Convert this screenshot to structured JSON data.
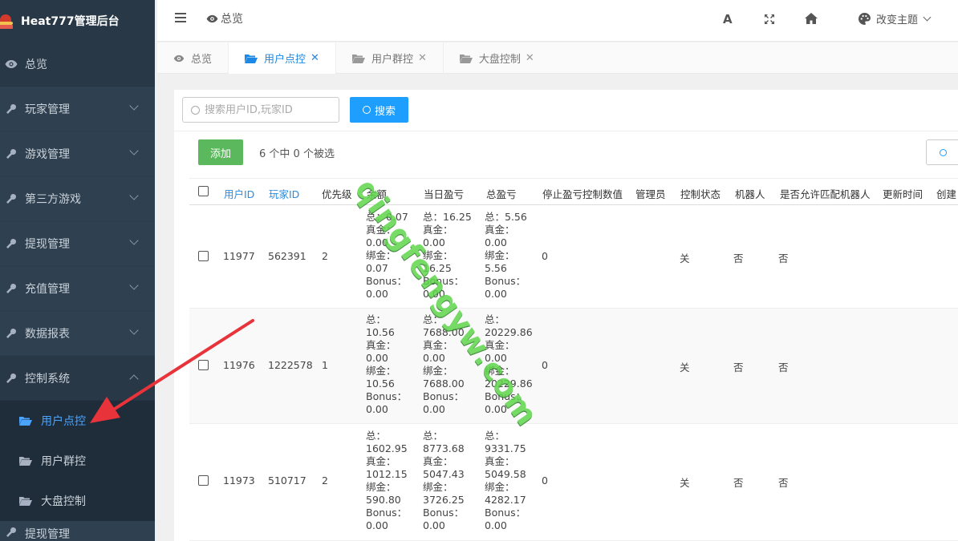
{
  "brand": {
    "title": "Heat777管理后台"
  },
  "sidebar": {
    "overview": "总览",
    "items": [
      {
        "label": "玩家管理",
        "icon": "wrench-icon"
      },
      {
        "label": "游戏管理",
        "icon": "wrench-icon"
      },
      {
        "label": "第三方游戏",
        "icon": "wrench-icon"
      },
      {
        "label": "提现管理",
        "icon": "wrench-icon"
      },
      {
        "label": "充值管理",
        "icon": "wrench-icon"
      },
      {
        "label": "数据报表",
        "icon": "wrench-icon"
      },
      {
        "label": "控制系统",
        "icon": "wrench-icon",
        "open": true
      }
    ],
    "sub_items": [
      {
        "label": "用户点控",
        "active": true
      },
      {
        "label": "用户群控"
      },
      {
        "label": "大盘控制"
      }
    ],
    "partial_next": "提现管理"
  },
  "header": {
    "breadcrumb": "总览",
    "theme_label": "改变主题"
  },
  "tabs": [
    {
      "label": "总览",
      "icon": "eye-icon",
      "closable": false
    },
    {
      "label": "用户点控",
      "icon": "folder-open-icon",
      "closable": true,
      "active": true
    },
    {
      "label": "用户群控",
      "icon": "folder-open-icon",
      "closable": true
    },
    {
      "label": "大盘控制",
      "icon": "folder-open-icon",
      "closable": true
    }
  ],
  "toolbar": {
    "search_placeholder": "搜索用户ID,玩家ID",
    "search_button": "搜索",
    "add_button": "添加",
    "selection_info": "6 个中 0 个被选"
  },
  "table": {
    "columns": [
      "用户ID",
      "玩家ID",
      "优先级",
      "余额",
      "当日盈亏",
      "总盈亏",
      "停止盈亏控制数值",
      "管理员",
      "控制状态",
      "机器人",
      "是否允许匹配机器人",
      "更新时间",
      "创建"
    ],
    "rows": [
      {
        "user_id": "11977",
        "player_id": "562391",
        "priority": "2",
        "balance": [
          "总：0.07",
          "真金：",
          "0.00",
          "绑金：",
          "0.07",
          "Bonus：",
          "0.00"
        ],
        "daily": [
          "总：16.25",
          "真金：",
          "0.00",
          "绑金：",
          "16.25",
          "Bonus：",
          "0.00"
        ],
        "total": [
          "总：5.56",
          "真金：",
          "0.00",
          "绑金：",
          "5.56",
          "Bonus：",
          "0.00"
        ],
        "stop_value": "0",
        "status": "关",
        "robot": "否",
        "allow_robot": "否"
      },
      {
        "user_id": "11976",
        "player_id": "1222578",
        "priority": "1",
        "balance": [
          "总：",
          "10.56",
          "真金：",
          "0.00",
          "绑金：",
          "10.56",
          "Bonus：",
          "0.00"
        ],
        "daily": [
          "总：",
          "7688.00",
          "真金：",
          "0.00",
          "绑金：",
          "7688.00",
          "Bonus：",
          "0.00"
        ],
        "total": [
          "总：",
          "20229.86",
          "真金：",
          "0.00",
          "绑金：",
          "20229.86",
          "Bonus：",
          "0.00"
        ],
        "stop_value": "0",
        "status": "关",
        "robot": "否",
        "allow_robot": "否"
      },
      {
        "user_id": "11973",
        "player_id": "510717",
        "priority": "2",
        "balance": [
          "总：",
          "1602.95",
          "真金：",
          "1012.15",
          "绑金：",
          "590.80",
          "Bonus：",
          "0.00"
        ],
        "daily": [
          "总：",
          "8773.68",
          "真金：",
          "5047.43",
          "绑金：",
          "3726.25",
          "Bonus：",
          "0.00"
        ],
        "total": [
          "总：",
          "9331.75",
          "真金：",
          "5049.58",
          "绑金：",
          "4282.17",
          "Bonus：",
          "0.00"
        ],
        "stop_value": "0",
        "status": "关",
        "robot": "否",
        "allow_robot": "否"
      }
    ]
  },
  "watermark": "qingfengyw.com",
  "colors": {
    "sidebar": "#2f4050",
    "accent": "#1e9fff",
    "add": "#5cb85c",
    "active_link": "#4aa3ff",
    "arrow": "#e8333a"
  }
}
